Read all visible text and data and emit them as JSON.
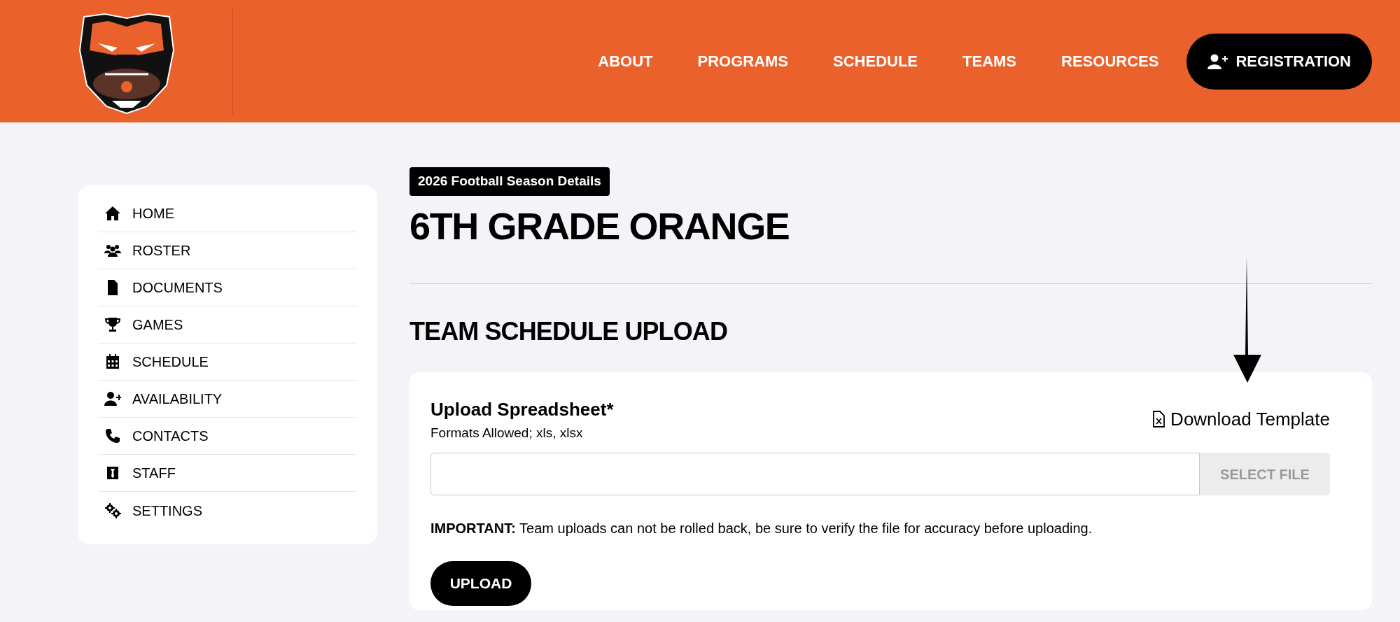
{
  "nav": {
    "items": [
      "ABOUT",
      "PROGRAMS",
      "SCHEDULE",
      "TEAMS",
      "RESOURCES"
    ],
    "cta": "REGISTRATION"
  },
  "sidebar": {
    "items": [
      "HOME",
      "ROSTER",
      "DOCUMENTS",
      "GAMES",
      "SCHEDULE",
      "AVAILABILITY",
      "CONTACTS",
      "STAFF",
      "SETTINGS"
    ]
  },
  "page": {
    "badge": "2026 Football Season Details",
    "title": "6TH GRADE ORANGE",
    "section_title": "TEAM SCHEDULE UPLOAD"
  },
  "upload": {
    "label": "Upload Spreadsheet*",
    "hint": "Formats Allowed; xls, xlsx",
    "template_link": "Download Template",
    "select_button": "SELECT FILE",
    "notice": "**IMPORTANT:** Team uploads can not be rolled back, be sure to verify the file for accuracy before uploading.",
    "submit": "UPLOAD"
  }
}
